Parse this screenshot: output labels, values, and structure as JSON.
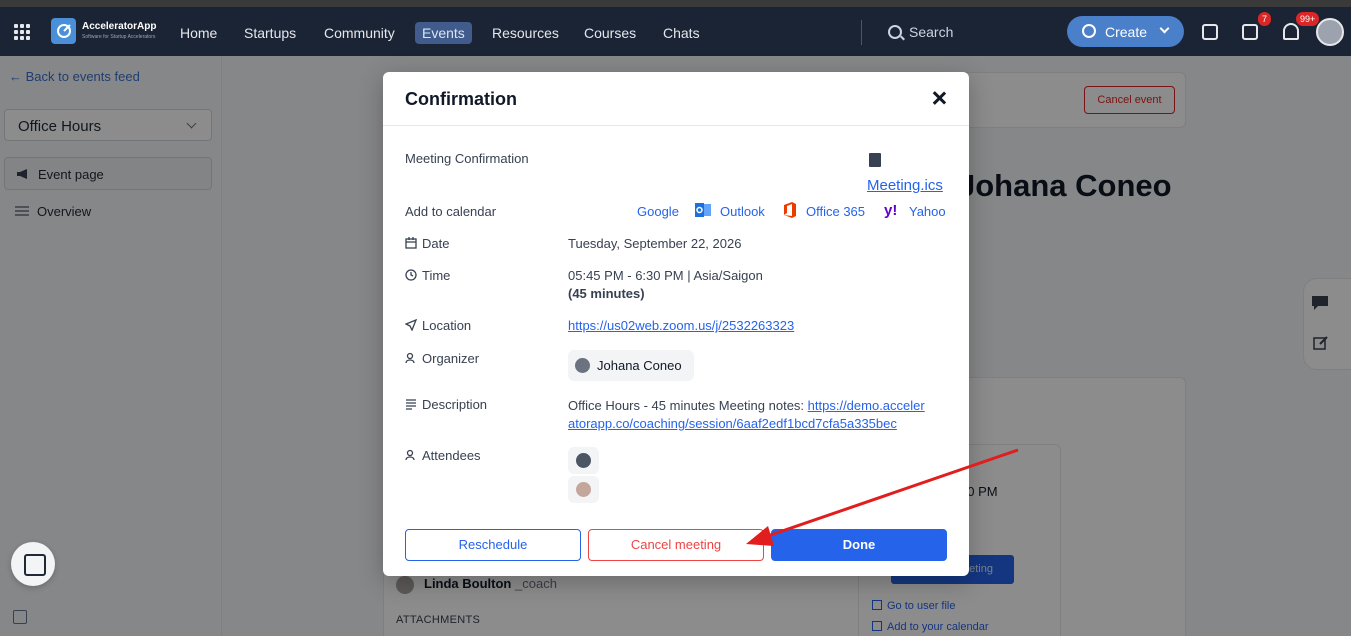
{
  "app": {
    "name": "AcceleratorApp",
    "tagline": "Software for Startup Accelerators"
  },
  "nav": {
    "links": [
      "Home",
      "Startups",
      "Community",
      "Events",
      "Resources",
      "Courses",
      "Chats"
    ],
    "active": "Events",
    "search_placeholder": "Search",
    "create_label": "Create",
    "tasks_badge": "7",
    "notifications_badge": "99+"
  },
  "sidebar": {
    "back_label": "Back to events feed",
    "dropdown_value": "Office Hours",
    "items": [
      {
        "label": "Event page",
        "active": true
      },
      {
        "label": "Overview",
        "active": false
      }
    ]
  },
  "background": {
    "cancel_event_label": "Cancel event",
    "title_fragment": "Johana Coneo",
    "time_fragment": "30 PM",
    "blue_button_fragment": "eeting",
    "links": [
      "Go to user file",
      "Add to your calendar"
    ],
    "coach_name": "Linda Boulton",
    "coach_role": "_coach",
    "attachments_label": "ATTACHMENTS"
  },
  "modal": {
    "title": "Confirmation",
    "meeting_confirmation_label": "Meeting Confirmation",
    "ics_label": "Meeting.ics",
    "add_to_calendar_label": "Add to calendar",
    "calendars": [
      "Google",
      "Outlook",
      "Office 365",
      "Yahoo"
    ],
    "date_label": "Date",
    "date_value": "Tuesday, September 22, 2026",
    "time_label": "Time",
    "time_value": "05:45 PM - 6:30 PM | Asia/Saigon",
    "duration_value": "(45 minutes)",
    "location_label": "Location",
    "location_url": "https://us02web.zoom.us/j/2532263323",
    "organizer_label": "Organizer",
    "organizer_name": "Johana Coneo",
    "description_label": "Description",
    "description_prefix": "Office Hours - 45 minutes Meeting notes: ",
    "description_url_line1": "https://demo.acceler",
    "description_url_line2": "atorapp.co/coaching/session/6aaf2edf1bcd7cfa5a335bec",
    "attendees_label": "Attendees",
    "buttons": {
      "reschedule": "Reschedule",
      "cancel": "Cancel meeting",
      "done": "Done"
    }
  },
  "colors": {
    "navbar": "#1b2434",
    "primary": "#2563eb",
    "danger": "#ef4444",
    "annotation_arrow": "#e11d1d"
  }
}
